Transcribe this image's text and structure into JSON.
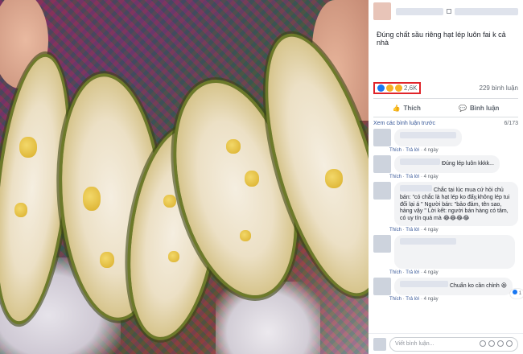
{
  "post": {
    "caption": "Đúng chất sầu riêng hạt lép luôn fai k cả nhà",
    "reaction_count": "2,6K",
    "comment_count": "229 bình luận"
  },
  "actions": {
    "like_label": "Thích",
    "comment_label": "Bình luận"
  },
  "comments_header": {
    "view_previous": "Xem các bình luận trước",
    "page": "6/173"
  },
  "comments": [
    {
      "text": "",
      "like": "Thích",
      "reply": "Trả lời",
      "time": "4 ngày"
    },
    {
      "text": "Đúng lép luôn kkkk...",
      "like": "Thích",
      "reply": "Trả lời",
      "time": "4 ngày"
    },
    {
      "text": "Chắc tại lúc mua cứ hỏi chủ bán: \"có chắc là hạt lép ko đấy,không lép tui đổi lại á \" Người bán: \"bảo đảm, tên sao, hàng vậy \" Lời kết: người bán hàng có tâm, có uy tín quá mà 😂😂😂😂",
      "like": "Thích",
      "reply": "Trả lời",
      "time": "4 ngày"
    },
    {
      "text": "",
      "like": "Thích",
      "reply": "Trả lời",
      "time": "4 ngày"
    },
    {
      "text": "Chuẩn ko cần chỉnh 😆",
      "like": "Thích",
      "reply": "Trả lời",
      "time": "4 ngày",
      "reactions": "1"
    }
  ],
  "composer": {
    "placeholder": "Viết bình luận..."
  },
  "colors": {
    "link": "#385898",
    "highlight": "#e0242a",
    "text_secondary": "#606770"
  }
}
